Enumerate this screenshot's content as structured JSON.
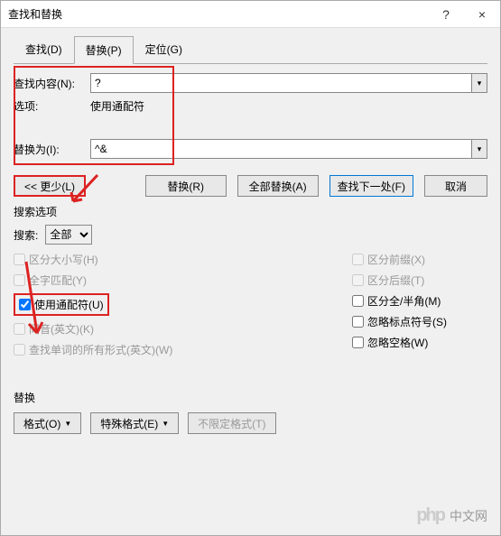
{
  "titlebar": {
    "title": "查找和替换",
    "help": "?",
    "close": "×"
  },
  "tabs": {
    "find": "查找(D)",
    "replace": "替换(P)",
    "goto": "定位(G)"
  },
  "find": {
    "label": "查找内容(N):",
    "value": "?"
  },
  "options_row": {
    "label": "选项:",
    "value": "使用通配符"
  },
  "replace": {
    "label": "替换为(I):",
    "value": "^&"
  },
  "buttons": {
    "less": "<< 更少(L)",
    "replace": "替换(R)",
    "replace_all": "全部替换(A)",
    "find_next": "查找下一处(F)",
    "cancel": "取消"
  },
  "search_options": {
    "header": "搜索选项",
    "search_label": "搜索:",
    "search_value": "全部",
    "left": {
      "case": "区分大小写(H)",
      "whole": "全字匹配(Y)",
      "wildcard": "使用通配符(U)",
      "homophone": "同音(英文)(K)",
      "wordforms": "查找单词的所有形式(英文)(W)"
    },
    "right": {
      "prefix": "区分前缀(X)",
      "suffix": "区分后缀(T)",
      "halfwidth": "区分全/半角(M)",
      "punct": "忽略标点符号(S)",
      "space": "忽略空格(W)"
    }
  },
  "replace_section": {
    "header": "替换",
    "format": "格式(O)",
    "special": "特殊格式(E)",
    "nofmt": "不限定格式(T)"
  },
  "watermark": "中文网"
}
